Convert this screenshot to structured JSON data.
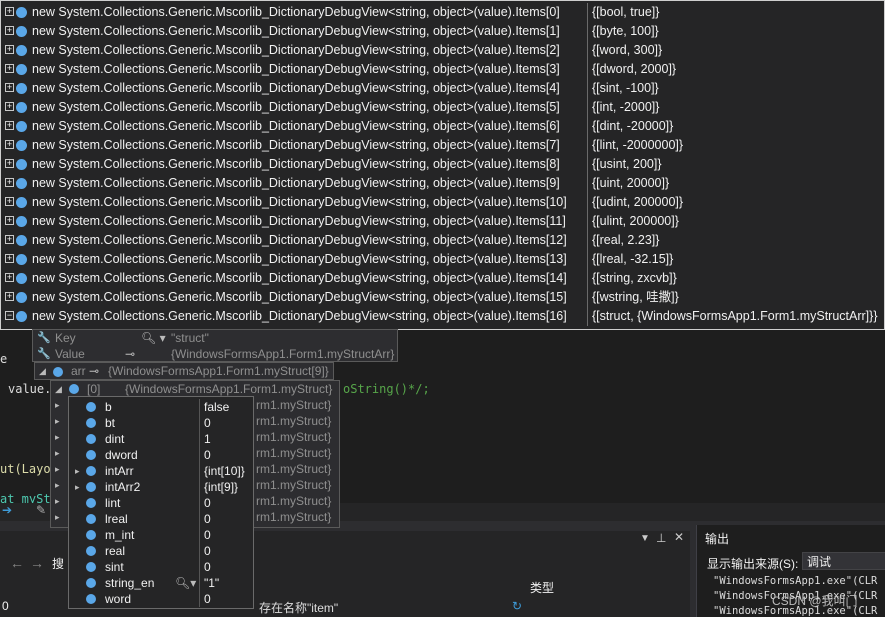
{
  "items_tip": {
    "rows": [
      {
        "name": "new System.Collections.Generic.Mscorlib_DictionaryDebugView<string, object>(value).Items[0]",
        "value": "{[bool, true]}"
      },
      {
        "name": "new System.Collections.Generic.Mscorlib_DictionaryDebugView<string, object>(value).Items[1]",
        "value": "{[byte, 100]}"
      },
      {
        "name": "new System.Collections.Generic.Mscorlib_DictionaryDebugView<string, object>(value).Items[2]",
        "value": "{[word, 300]}"
      },
      {
        "name": "new System.Collections.Generic.Mscorlib_DictionaryDebugView<string, object>(value).Items[3]",
        "value": "{[dword, 2000]}"
      },
      {
        "name": "new System.Collections.Generic.Mscorlib_DictionaryDebugView<string, object>(value).Items[4]",
        "value": "{[sint, -100]}"
      },
      {
        "name": "new System.Collections.Generic.Mscorlib_DictionaryDebugView<string, object>(value).Items[5]",
        "value": "{[int, -2000]}"
      },
      {
        "name": "new System.Collections.Generic.Mscorlib_DictionaryDebugView<string, object>(value).Items[6]",
        "value": "{[dint, -20000]}"
      },
      {
        "name": "new System.Collections.Generic.Mscorlib_DictionaryDebugView<string, object>(value).Items[7]",
        "value": "{[lint, -2000000]}"
      },
      {
        "name": "new System.Collections.Generic.Mscorlib_DictionaryDebugView<string, object>(value).Items[8]",
        "value": "{[usint, 200]}"
      },
      {
        "name": "new System.Collections.Generic.Mscorlib_DictionaryDebugView<string, object>(value).Items[9]",
        "value": "{[uint, 20000]}"
      },
      {
        "name": "new System.Collections.Generic.Mscorlib_DictionaryDebugView<string, object>(value).Items[10]",
        "value": "{[udint, 200000]}"
      },
      {
        "name": "new System.Collections.Generic.Mscorlib_DictionaryDebugView<string, object>(value).Items[11]",
        "value": "{[ulint, 200000]}"
      },
      {
        "name": "new System.Collections.Generic.Mscorlib_DictionaryDebugView<string, object>(value).Items[12]",
        "value": "{[real, 2.23]}"
      },
      {
        "name": "new System.Collections.Generic.Mscorlib_DictionaryDebugView<string, object>(value).Items[13]",
        "value": "{[lreal, -32.15]}"
      },
      {
        "name": "new System.Collections.Generic.Mscorlib_DictionaryDebugView<string, object>(value).Items[14]",
        "value": "{[string, zxcvb]}"
      },
      {
        "name": "new System.Collections.Generic.Mscorlib_DictionaryDebugView<string, object>(value).Items[15]",
        "value": "{[wstring, 哇撒]}"
      },
      {
        "name": "new System.Collections.Generic.Mscorlib_DictionaryDebugView<string, object>(value).Items[16]",
        "value": "{[struct, {WindowsFormsApp1.Form1.myStructArr]}}"
      }
    ]
  },
  "kv_tip": {
    "key_label": "Key",
    "key_value": "\"struct\"",
    "value_label": "Value",
    "value_value": "{WindowsFormsApp1.Form1.myStructArr}"
  },
  "arr_tip": {
    "label": "arr",
    "value": "{WindowsFormsApp1.Form1.myStruct[9]}"
  },
  "elem_tip": {
    "index_label": "[0]",
    "first_value": "{WindowsFormsApp1.Form1.myStruct}",
    "repeat_value": "rm1.myStruct}"
  },
  "fields_tip": {
    "rows": [
      {
        "name": "b",
        "value": "false"
      },
      {
        "name": "bt",
        "value": "0"
      },
      {
        "name": "dint",
        "value": "1"
      },
      {
        "name": "dword",
        "value": "0"
      },
      {
        "name": "intArr",
        "value": "{int[10]}"
      },
      {
        "name": "intArr2",
        "value": "{int[9]}"
      },
      {
        "name": "lint",
        "value": "0"
      },
      {
        "name": "lreal",
        "value": "0"
      },
      {
        "name": "m_int",
        "value": "0"
      },
      {
        "name": "real",
        "value": "0"
      },
      {
        "name": "sint",
        "value": "0"
      },
      {
        "name": "string_en",
        "value": "\"1\""
      },
      {
        "name": "word",
        "value": "0"
      }
    ]
  },
  "editor": {
    "line1": "e",
    "line2": "value.",
    "line2_tail": "oString()*/;",
    "line3": "ut(Layo",
    "line4": "at myStr"
  },
  "bottom": {
    "search_label": "搜",
    "type_header": "类型",
    "left_value": "0",
    "status_msg": "存在名称\"item\"",
    "output_title": "输出",
    "output_source_label": "显示输出来源(S):",
    "output_source_value": "调试",
    "output_lines": [
      "\"WindowsFormsApp1.exe\"(CLR",
      "\"WindowsFormsApp1.exe\"(CLR",
      "\"WindowsFormsApp1.exe\"(CLR"
    ],
    "watermark": "CSDN @我叫门"
  },
  "colors": {
    "accent": "#007acc",
    "icon": "#5aa7e8",
    "background": "#1e1e1e"
  }
}
